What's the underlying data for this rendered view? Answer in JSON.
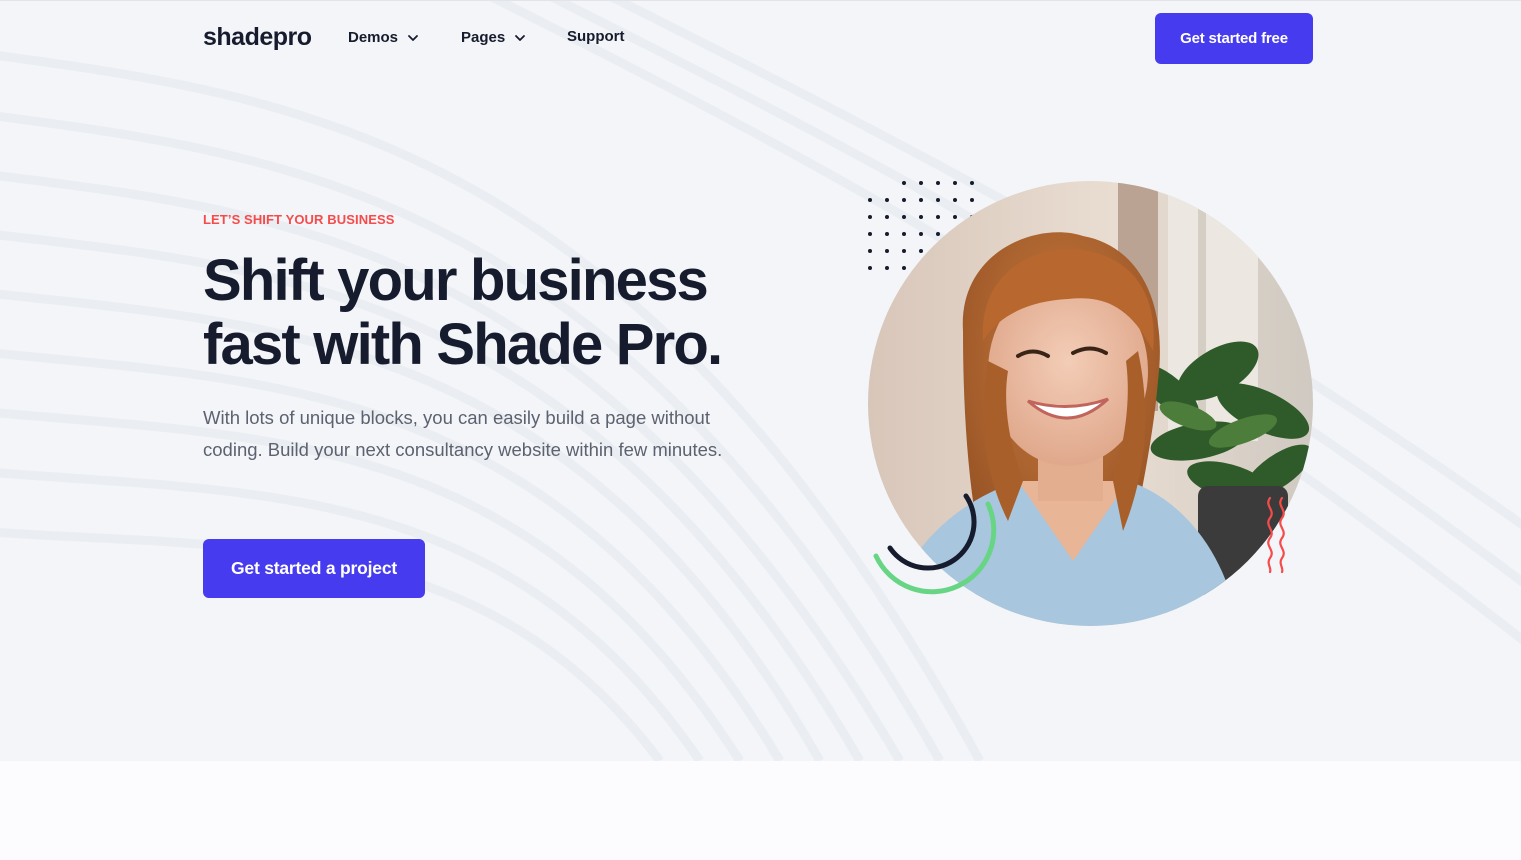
{
  "header": {
    "logo": "shadepro",
    "nav": [
      {
        "label": "Demos",
        "has_dropdown": true
      },
      {
        "label": "Pages",
        "has_dropdown": true
      },
      {
        "label": "Support",
        "has_dropdown": false
      }
    ],
    "cta_label": "Get started free"
  },
  "hero": {
    "eyebrow": "LET’S SHIFT YOUR BUSINESS",
    "headline_line1": "Shift your business",
    "headline_line2": "fast with Shade Pro.",
    "lead": "With lots of unique blocks, you can easily build a page without coding. Build your next consultancy website within few minutes.",
    "cta_label": "Get started a project",
    "image_icon": "smiling-woman-photo"
  },
  "colors": {
    "accent": "#473bf0",
    "eyebrow": "#f64b4b",
    "heading": "#161c2d",
    "body_text": "#5d6270",
    "deco_green": "#68d585",
    "deco_red": "#f64b4b",
    "deco_navy": "#161c2d"
  }
}
